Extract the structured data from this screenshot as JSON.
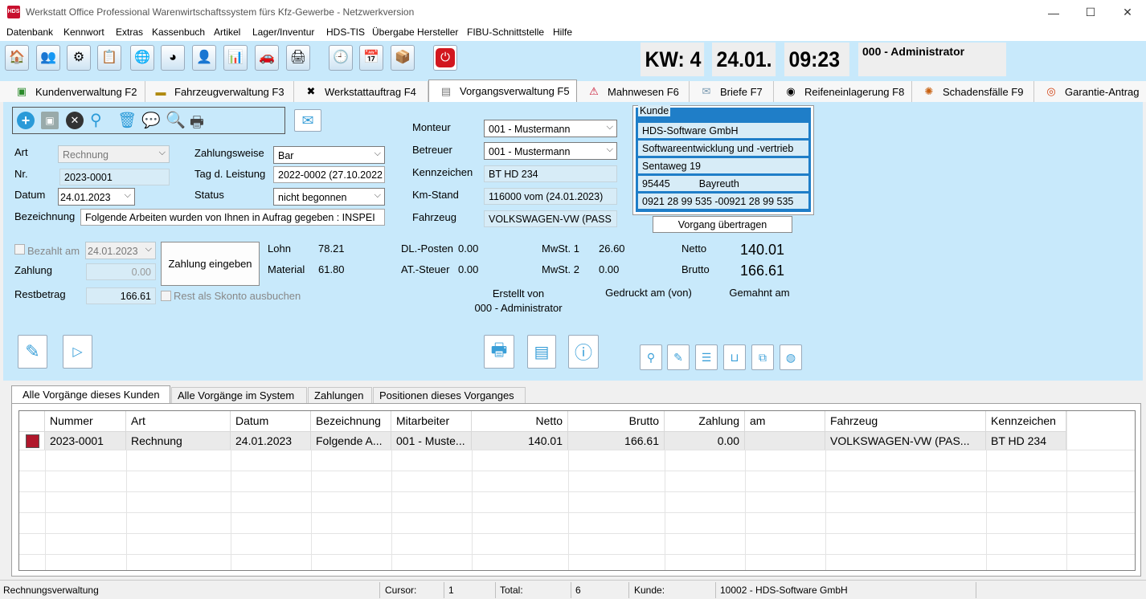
{
  "window": {
    "app_icon": "HDS",
    "title": "Werkstatt Office Professional Warenwirtschaftssystem fürs Kfz-Gewerbe - Netzwerkversion",
    "minimize": "—",
    "maximize": "☐",
    "close": "✕"
  },
  "menu": [
    "Datenbank",
    "Kennwort",
    "Extras",
    "Kassenbuch",
    "Artikel",
    "Lager/Inventur",
    "HDS-TIS",
    "Übergabe Hersteller",
    "FIBU-Schnittstelle",
    "Hilfe"
  ],
  "header": {
    "week": "KW: 4",
    "date": "24.01.",
    "time": "09:23",
    "user": "000 - Administrator"
  },
  "tabs": [
    {
      "label": "Kundenverwaltung F2",
      "icon": "customer-icon"
    },
    {
      "label": "Fahrzeugverwaltung F3",
      "icon": "car-icon"
    },
    {
      "label": "Werkstattauftrag F4",
      "icon": "tools-icon"
    },
    {
      "label": "Vorgangsverwaltung F5",
      "icon": "document-icon",
      "active": true
    },
    {
      "label": "Mahnwesen F6",
      "icon": "warning-icon"
    },
    {
      "label": "Briefe F7",
      "icon": "envelope-icon"
    },
    {
      "label": "Reifeneinlagerung F8",
      "icon": "tire-icon"
    },
    {
      "label": "Schadensfälle F9",
      "icon": "gear-icon"
    },
    {
      "label": "Garantie-Antrag",
      "icon": "badge-icon"
    }
  ],
  "form": {
    "art_label": "Art",
    "art_value": "Rechnung",
    "nr_label": "Nr.",
    "nr_value": "2023-0001",
    "datum_label": "Datum",
    "datum_value": "24.01.2023",
    "bezeichnung_label": "Bezeichnung",
    "bezeichnung_value": "Folgende Arbeiten wurden von Ihnen in Aufrag gegeben :  INSPEI",
    "zahlungsweise_label": "Zahlungsweise",
    "zahlungsweise_value": "Bar",
    "leistung_label": "Tag d. Leistung",
    "leistung_value": "2022-0002 (27.10.2022",
    "status_label": "Status",
    "status_value": "nicht begonnen",
    "monteur_label": "Monteur",
    "monteur_value": "001 - Mustermann",
    "betreuer_label": "Betreuer",
    "betreuer_value": "001 - Mustermann",
    "kennzeichen_label": "Kennzeichen",
    "kennzeichen_value": "BT HD 234",
    "kmstand_label": "Km-Stand",
    "kmstand_value": "116000 vom (24.01.2023)",
    "fahrzeug_label": "Fahrzeug",
    "fahrzeug_value": "VOLKSWAGEN-VW (PASS",
    "kunde_title": "Kunde",
    "kunde_lines": [
      "HDS-Software GmbH",
      "Softwareentwicklung und -vertrieb",
      "Sentaweg 19"
    ],
    "kunde_plz": "95445",
    "kunde_ort": "Bayreuth",
    "kunde_phone": "0921 28 99 535 -00921 28 99 535",
    "vorgang_btn": "Vorgang übertragen"
  },
  "payment": {
    "bezahlt_label": "Bezahlt am",
    "bezahlt_date": "24.01.2023",
    "zahlung_label": "Zahlung",
    "zahlung_value": "0.00",
    "restbetrag_label": "Restbetrag",
    "restbetrag_value": "166.61",
    "zahlung_btn": "Zahlung eingeben",
    "skonto_label": "Rest als Skonto ausbuchen",
    "lohn_label": "Lohn",
    "lohn_value": "78.21",
    "material_label": "Material",
    "material_value": "61.80",
    "dl_label": "DL.-Posten",
    "dl_value": "0.00",
    "at_label": "AT.-Steuer",
    "at_value": "0.00",
    "mwst1_label": "MwSt. 1",
    "mwst1_value": "26.60",
    "mwst2_label": "MwSt. 2",
    "mwst2_value": "0.00",
    "netto_label": "Netto",
    "netto_value": "140.01",
    "brutto_label": "Brutto",
    "brutto_value": "166.61",
    "erstellt_label": "Erstellt von",
    "erstellt_value": "000 - Administrator",
    "gedruckt_label": "Gedruckt am (von)",
    "gemahnt_label": "Gemahnt am"
  },
  "grid_tabs": [
    "Alle Vorgänge dieses Kunden",
    "Alle Vorgänge im System",
    "Zahlungen",
    "Positionen dieses Vorganges"
  ],
  "grid": {
    "columns": [
      "Nummer",
      "Art",
      "Datum",
      "Bezeichnung",
      "Mitarbeiter",
      "Netto",
      "Brutto",
      "Zahlung",
      "am",
      "Fahrzeug",
      "Kennzeichen"
    ],
    "rows": [
      [
        "2023-0001",
        "Rechnung",
        "24.01.2023",
        "Folgende A...",
        "001 - Muste...",
        "140.01",
        "166.61",
        "0.00",
        "",
        "VOLKSWAGEN-VW (PAS...",
        "BT HD 234"
      ]
    ],
    "row_marker_color": "#b0182c"
  },
  "status": {
    "left": "Rechnungsverwaltung",
    "cursor_label": "Cursor:",
    "cursor_value": "1",
    "total_label": "Total:",
    "total_value": "6",
    "kunde_label": "Kunde:",
    "kunde_value": "10002 - HDS-Software GmbH"
  },
  "colors": {
    "accent": "#c8e9fb",
    "icon_blue": "#3a9fd8",
    "marker": "#b0182c"
  }
}
